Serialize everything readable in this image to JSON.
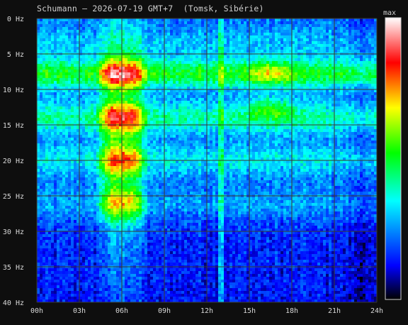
{
  "chart_data": {
    "type": "heatmap",
    "title": "Schumann – 2026-07-19 GMT+7  (Tomsk, Sibérie)",
    "xlabel": "",
    "ylabel": "",
    "x_ticks": [
      "00h",
      "03h",
      "06h",
      "09h",
      "12h",
      "15h",
      "18h",
      "21h",
      "24h"
    ],
    "y_ticks": [
      "0 Hz",
      "5 Hz",
      "10 Hz",
      "15 Hz",
      "20 Hz",
      "25 Hz",
      "30 Hz",
      "35 Hz",
      "40 Hz"
    ],
    "xlim": [
      0,
      24
    ],
    "ylim": [
      0,
      40
    ],
    "x_unit": "h",
    "y_unit": "Hz",
    "grid": true,
    "colorbar": {
      "label": "max",
      "colors": [
        "#000000",
        "#0000ff",
        "#00ffff",
        "#00ff00",
        "#ffff00",
        "#ff0000",
        "#ffffff"
      ]
    },
    "resonance_bands_hz": [
      7.8,
      14,
      20,
      26
    ],
    "high_intensity_periods": [
      {
        "start_h": 4.5,
        "end_h": 7.5,
        "freq_hz": [
          7.8,
          14,
          20,
          26
        ],
        "level": "max"
      },
      {
        "start_h": 12.8,
        "end_h": 13.2,
        "freq_hz": [
          0,
          40
        ],
        "level": "high"
      },
      {
        "start_h": 15.0,
        "end_h": 18.0,
        "freq_hz": [
          7.8,
          12.8
        ],
        "level": "high"
      }
    ]
  }
}
